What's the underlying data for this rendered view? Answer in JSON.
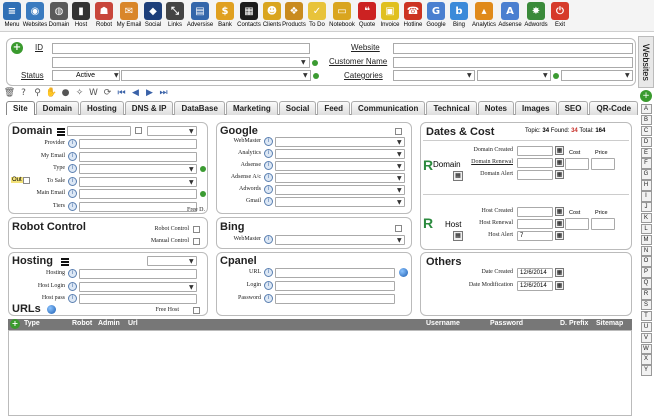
{
  "toolbar": [
    {
      "label": "Menu",
      "icon": "menu-icon",
      "color": "#2f6fb5",
      "glyph": "≡"
    },
    {
      "label": "Websites",
      "icon": "websites-icon",
      "color": "#3a7bbf",
      "glyph": "◉"
    },
    {
      "label": "Domain",
      "icon": "domain-icon",
      "color": "#5a5a5a",
      "glyph": "◍"
    },
    {
      "label": "Host",
      "icon": "host-icon",
      "color": "#333333",
      "glyph": "▮"
    },
    {
      "label": "Robot",
      "icon": "robot-icon",
      "color": "#c8463b",
      "glyph": "☗"
    },
    {
      "label": "My Email",
      "icon": "email-icon",
      "color": "#d9862a",
      "glyph": "✉"
    },
    {
      "label": "Social",
      "icon": "social-icon",
      "color": "#1d3f7a",
      "glyph": "◆"
    },
    {
      "label": "Links",
      "icon": "links-icon",
      "color": "#444444",
      "glyph": "⤡"
    },
    {
      "label": "Adversise",
      "icon": "advertise-icon",
      "color": "#3366aa",
      "glyph": "▤"
    },
    {
      "label": "Bank",
      "icon": "bank-icon",
      "color": "#e0a020",
      "glyph": "$"
    },
    {
      "label": "Contacts",
      "icon": "contacts-icon",
      "color": "#1b1b1b",
      "glyph": "▦"
    },
    {
      "label": "Clients",
      "icon": "clients-icon",
      "color": "#d9a51f",
      "glyph": "☻"
    },
    {
      "label": "Products",
      "icon": "products-icon",
      "color": "#c98b1e",
      "glyph": "❖"
    },
    {
      "label": "To Do",
      "icon": "todo-icon",
      "color": "#e8c33a",
      "glyph": "✓"
    },
    {
      "label": "Notebook",
      "icon": "notebook-icon",
      "color": "#d9a51f",
      "glyph": "▭"
    },
    {
      "label": "Quote",
      "icon": "quote-icon",
      "color": "#cc2222",
      "glyph": "❝"
    },
    {
      "label": "Invoice",
      "icon": "invoice-icon",
      "color": "#e0c020",
      "glyph": "▣"
    },
    {
      "label": "Hotline",
      "icon": "hotline-icon",
      "color": "#cc3322",
      "glyph": "☎"
    },
    {
      "label": "Google",
      "icon": "google-icon",
      "color": "#4a7fd0",
      "glyph": "G"
    },
    {
      "label": "Bing",
      "icon": "bing-icon",
      "color": "#3b8ad9",
      "glyph": "b"
    },
    {
      "label": "Analytics",
      "icon": "analytics-icon",
      "color": "#e08a1a",
      "glyph": "▴"
    },
    {
      "label": "Adsense",
      "icon": "adsense-icon",
      "color": "#4a7fd0",
      "glyph": "A"
    },
    {
      "label": "Adwords",
      "icon": "adwords-icon",
      "color": "#3a8a3a",
      "glyph": "✸"
    },
    {
      "label": "Exit",
      "icon": "exit-icon",
      "color": "#d63a2a",
      "glyph": "⏻"
    }
  ],
  "header": {
    "id_label": "ID",
    "status_label": "Status",
    "status_value": "Active",
    "website_label": "Website",
    "customer_label": "Customer Name",
    "categories_label": "Categories",
    "side_tab": "Websites"
  },
  "icon_strip": [
    {
      "icon": "trash-icon",
      "glyph": "🗑"
    },
    {
      "icon": "help-icon",
      "glyph": "?"
    },
    {
      "icon": "search-icon",
      "glyph": "⚲"
    },
    {
      "icon": "hand-icon",
      "glyph": "✋"
    },
    {
      "icon": "ok-icon",
      "glyph": "●"
    },
    {
      "icon": "wrench-icon",
      "glyph": "✧"
    },
    {
      "icon": "whois-icon",
      "glyph": "W"
    },
    {
      "icon": "reload-icon",
      "glyph": "⟳"
    },
    {
      "icon": "first-icon",
      "glyph": "⏮"
    },
    {
      "icon": "prev-icon",
      "glyph": "◀"
    },
    {
      "icon": "next-icon",
      "glyph": "▶"
    },
    {
      "icon": "last-icon",
      "glyph": "⏭"
    }
  ],
  "tabs": [
    "Site",
    "Domain",
    "Hosting",
    "DNS & IP",
    "DataBase",
    "Marketing",
    "Social",
    "Feed",
    "Communication",
    "Technical",
    "Notes",
    "Images",
    "SEO",
    "QR-Code"
  ],
  "alphabet": [
    "A",
    "B",
    "C",
    "D",
    "E",
    "F",
    "G",
    "H",
    "I",
    "J",
    "K",
    "L",
    "M",
    "N",
    "O",
    "P",
    "Q",
    "R",
    "S",
    "T",
    "U",
    "V",
    "W",
    "X",
    "Y"
  ],
  "domain_panel": {
    "title": "Domain",
    "fields": [
      "Provider",
      "My Email",
      "Type",
      "To Sale",
      "Main Email",
      "Tiers"
    ],
    "out_label": "Out",
    "free_label": "Free D."
  },
  "robot_panel": {
    "title": "Robot Control",
    "robot_label": "Robot Control",
    "manual_label": "Manual Control"
  },
  "hosting_panel": {
    "title": "Hosting",
    "fields": [
      "Hosting",
      "Host Login",
      "Host pass"
    ],
    "free_label": "Free Host"
  },
  "google_panel": {
    "title": "Google",
    "fields": [
      "WebMaster",
      "Analytics",
      "Adsense",
      "Adsense A/c",
      "Adwords",
      "Gmail"
    ]
  },
  "bing_panel": {
    "title": "Bing",
    "fields": [
      "WebMaster"
    ]
  },
  "cpanel_panel": {
    "title": "Cpanel",
    "fields": [
      "URL",
      "Login",
      "Password"
    ]
  },
  "dates_panel": {
    "title": "Dates & Cost",
    "topic_label": "Topic:",
    "topic_value": "34",
    "found_label": "Found:",
    "found_value": "34",
    "total_label": "Total:",
    "total_value": "164",
    "domain_label": "Domain",
    "domain_fields": [
      "Domain Created",
      "Domain Renewal",
      "Domain Alert"
    ],
    "host_label": "Host",
    "host_fields": [
      "Host Created",
      "Host Renewal",
      "Host Alert"
    ],
    "host_alert_value": "7",
    "cost_label": "Cost",
    "price_label": "Price"
  },
  "others_panel": {
    "title": "Others",
    "date_created_label": "Date Created",
    "date_created_value": "12/6/2014",
    "date_mod_label": "Date Modification",
    "date_mod_value": "12/6/2014"
  },
  "urls": {
    "title": "URLs",
    "columns": [
      "Type",
      "Robot",
      "Admin",
      "Url",
      "Username",
      "Password",
      "D. Prefix",
      "Sitemap"
    ]
  }
}
